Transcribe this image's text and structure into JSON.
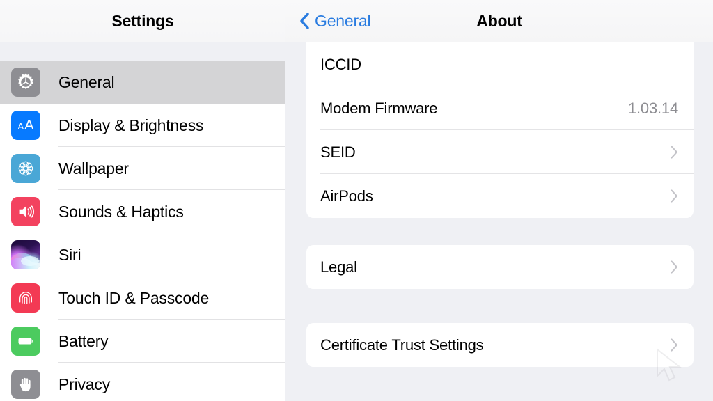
{
  "sidebar": {
    "header": {
      "title": "Settings"
    },
    "items": [
      {
        "label": "General",
        "icon": "gear-icon",
        "selected": true,
        "icon_color": "#8e8e93"
      },
      {
        "label": "Display & Brightness",
        "icon": "text-size-icon",
        "selected": false,
        "icon_color": "#077aff"
      },
      {
        "label": "Wallpaper",
        "icon": "flower-icon",
        "selected": false,
        "icon_color": "#4aa7d6"
      },
      {
        "label": "Sounds & Haptics",
        "icon": "speaker-icon",
        "selected": false,
        "icon_color": "#f3425f"
      },
      {
        "label": "Siri",
        "icon": "siri-waveform-icon",
        "selected": false,
        "icon_color": "#2a1150"
      },
      {
        "label": "Touch ID & Passcode",
        "icon": "fingerprint-icon",
        "selected": false,
        "icon_color": "#f33a54"
      },
      {
        "label": "Battery",
        "icon": "battery-icon",
        "selected": false,
        "icon_color": "#4ccb5f"
      },
      {
        "label": "Privacy",
        "icon": "hand-icon",
        "selected": false,
        "icon_color": "#8e8e93"
      }
    ]
  },
  "detail": {
    "header": {
      "back_label": "General",
      "back_icon": "chevron-left-icon",
      "title": "About"
    },
    "groups": [
      {
        "rows": [
          {
            "label": "ICCID",
            "value": "",
            "accessory": "none"
          },
          {
            "label": "Modem Firmware",
            "value": "1.03.14",
            "accessory": "none"
          },
          {
            "label": "SEID",
            "value": "",
            "accessory": "chevron-right-icon"
          },
          {
            "label": "AirPods",
            "value": "",
            "accessory": "chevron-right-icon"
          }
        ]
      },
      {
        "rows": [
          {
            "label": "Legal",
            "value": "",
            "accessory": "chevron-right-icon"
          }
        ]
      },
      {
        "rows": [
          {
            "label": "Certificate Trust Settings",
            "value": "",
            "accessory": "chevron-right-icon"
          }
        ]
      }
    ]
  },
  "colors": {
    "accent_blue": "#2a7ce0",
    "panel_background": "#eff0f4",
    "card_background": "#ffffff",
    "selected_row": "#d4d4d6",
    "separator": "#e2e2e4",
    "secondary_text": "#8d8d92",
    "chevron": "#c3c3c8"
  }
}
